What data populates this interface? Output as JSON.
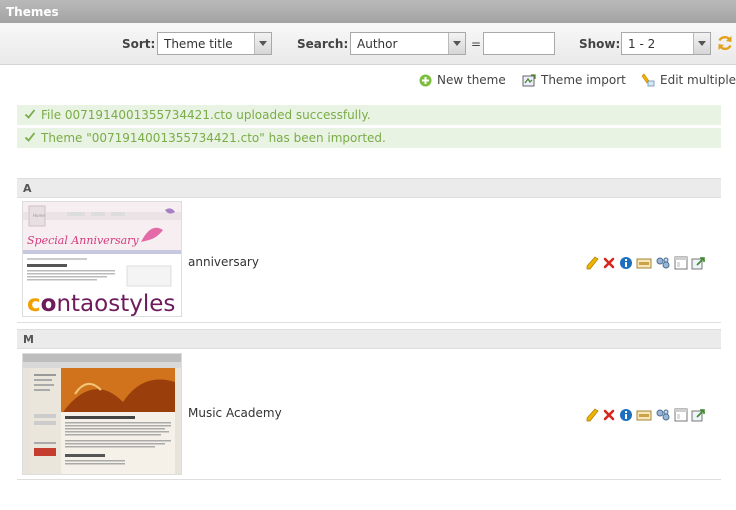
{
  "window": {
    "title": "Themes"
  },
  "filters": {
    "sort_label": "Sort:",
    "sort_value": "Theme title",
    "search_label": "Search:",
    "search_field_value": "Author",
    "equals": "=",
    "search_text": "",
    "show_label": "Show:",
    "show_value": "1 - 2"
  },
  "actions": {
    "new_theme": "New theme",
    "theme_import": "Theme import",
    "edit_multiple": "Edit multiple"
  },
  "messages": [
    "File 0071914001355734421.cto uploaded successfully.",
    "Theme \"0071914001355734421.cto\" has been imported."
  ],
  "groups": [
    {
      "letter": "A",
      "theme": {
        "name": "anniversary",
        "thumb_title": "Special Anniversary",
        "thumb_logo": "contaostyles",
        "thumb_logo_c": "c",
        "thumb_logo_o": "o",
        "thumb_logo_rest": "ntaostyles"
      }
    },
    {
      "letter": "M",
      "theme": {
        "name": "Music Academy"
      }
    }
  ],
  "colors": {
    "success_text": "#7aac47",
    "success_bg": "#e9f3e3",
    "edit": "#f0b400",
    "delete": "#d7261e",
    "info": "#1f6fc1"
  }
}
